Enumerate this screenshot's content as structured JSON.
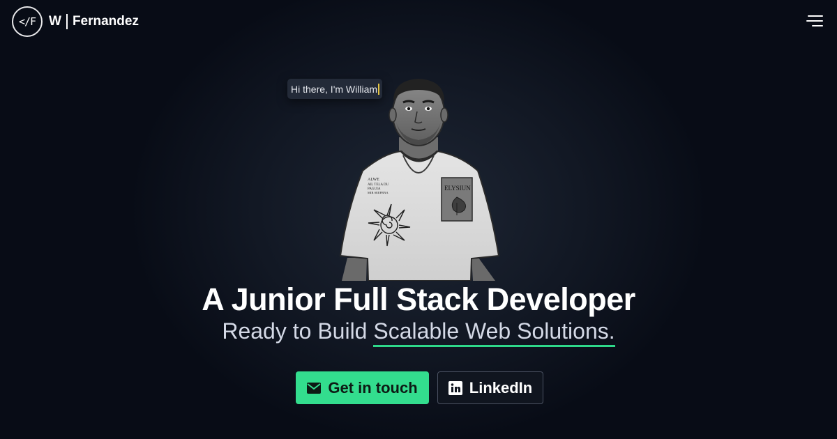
{
  "nav": {
    "logo_text": "</F",
    "brand_first": "W",
    "brand_last": "Fernandez",
    "menu_icon": "hamburger-menu-icon"
  },
  "hero": {
    "speech_text": "Hi there, I'm William",
    "headline": "A Junior Full Stack Developer",
    "subline_prefix": "Ready to Build",
    "subline_highlight": "Scalable Web Solutions.",
    "highlight_color": "#2ed88a",
    "shirt_text_left": [
      "ALWE",
      "AIL TELA DU",
      "PAGUIA",
      "MIR SEEFRNA"
    ],
    "shirt_pocket_text": "ELYSIUN"
  },
  "actions": {
    "contact_label": "Get in touch",
    "contact_icon": "envelope-icon",
    "linkedin_label": "LinkedIn",
    "linkedin_icon": "linkedin-icon"
  },
  "colors": {
    "accent": "#33dd8e",
    "background": "#070b16"
  }
}
